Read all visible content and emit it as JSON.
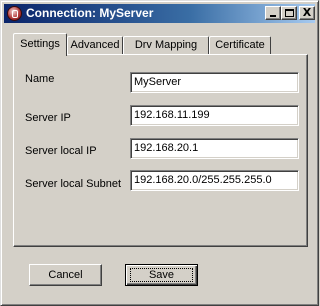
{
  "window": {
    "title": "Connection: MyServer",
    "app_icon": "connection-icon",
    "caption_buttons": {
      "minimize": "minimize-icon",
      "maximize": "maximize-icon",
      "close": "close-icon"
    },
    "close_glyph": "X"
  },
  "tabs": [
    {
      "label": "Settings",
      "active": true
    },
    {
      "label": "Advanced",
      "active": false
    },
    {
      "label": "Drv Mapping",
      "active": false
    },
    {
      "label": "Certificate",
      "active": false
    }
  ],
  "fields": {
    "name": {
      "label": "Name",
      "value": "MyServer"
    },
    "server_ip": {
      "label": "Server IP",
      "value": "192.168.11.199"
    },
    "server_local_ip": {
      "label": "Server local IP",
      "value": "192.168.20.1"
    },
    "server_local_subnet": {
      "label": "Server local Subnet",
      "value": "192.168.20.0/255.255.255.0"
    }
  },
  "buttons": {
    "cancel": "Cancel",
    "save": "Save"
  }
}
